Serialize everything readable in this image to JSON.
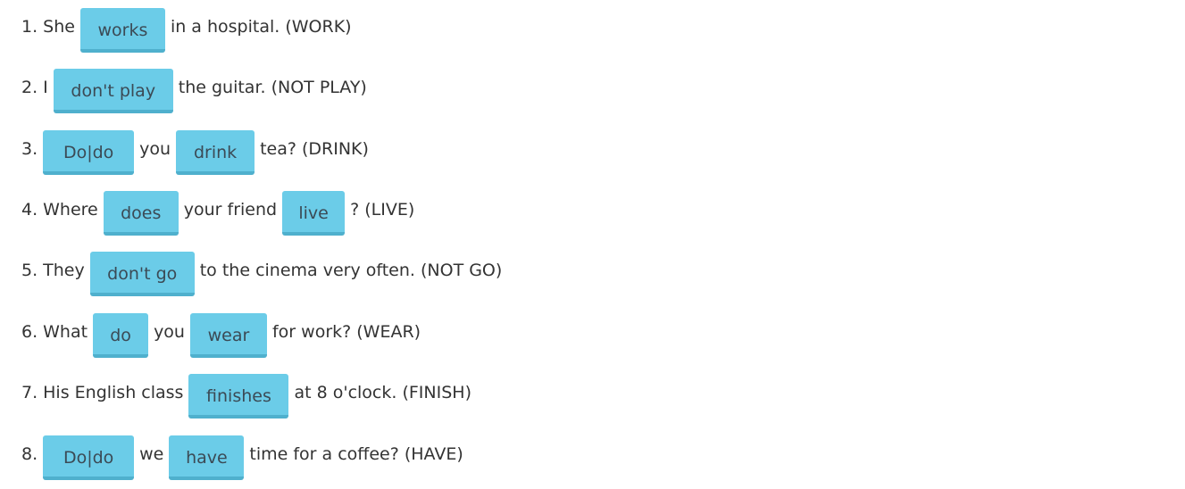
{
  "exercise": {
    "items": [
      {
        "num": "1.",
        "pre": "She",
        "gap1": "works",
        "post": "in a hospital. (WORK)"
      },
      {
        "num": "2.",
        "pre": "I",
        "gap1": "don't play",
        "post": "the guitar. (NOT PLAY)"
      },
      {
        "num": "3.",
        "gap1": "Do|do",
        "mid": "you",
        "gap2": "drink",
        "post": "tea? (DRINK)"
      },
      {
        "num": "4.",
        "pre": "Where",
        "gap1": "does",
        "mid": "your friend",
        "gap2": "live",
        "post": "? (LIVE)"
      },
      {
        "num": "5.",
        "pre": "They",
        "gap1": "don't go",
        "post": "to the cinema very often. (NOT GO)"
      },
      {
        "num": "6.",
        "pre": "What",
        "gap1": "do",
        "mid": "you",
        "gap2": "wear",
        "post": "for work? (WEAR)"
      },
      {
        "num": "7.",
        "pre": "His English class",
        "gap1": "finishes",
        "post": "at 8 o'clock. (FINISH)"
      },
      {
        "num": "8.",
        "gap1": "Do|do",
        "mid": "we",
        "gap2": "have",
        "post": "time for a coffee? (HAVE)"
      }
    ]
  },
  "colors": {
    "gap_background": "#6bcce8",
    "gap_border": "#4fb0cd",
    "text": "#333333"
  }
}
